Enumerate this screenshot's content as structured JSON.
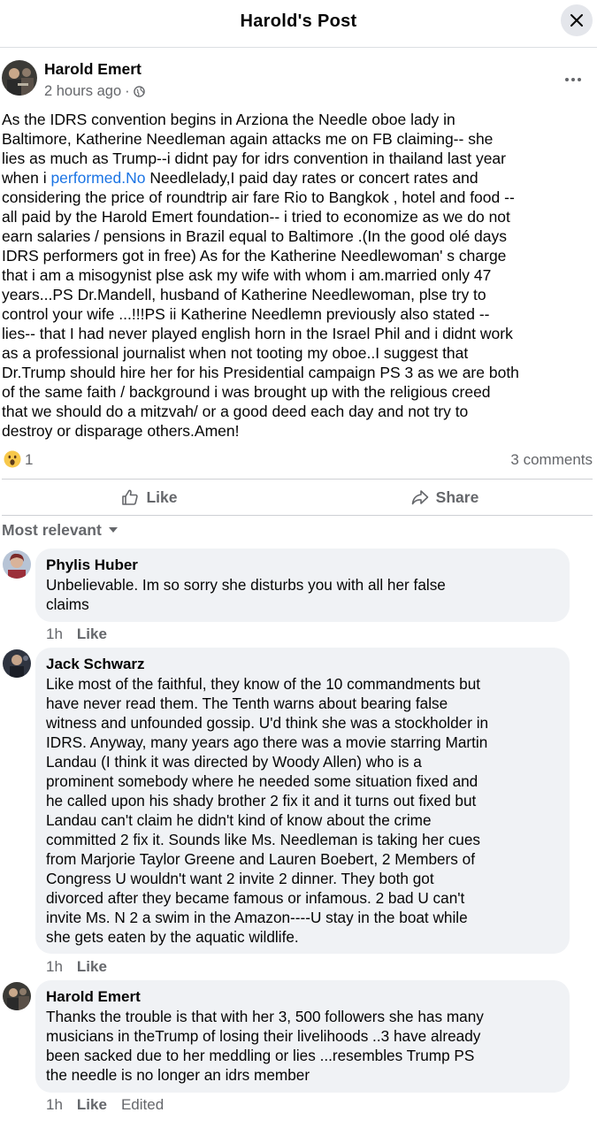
{
  "header": {
    "title": "Harold's Post"
  },
  "post": {
    "author": "Harold Emert",
    "time": "2 hours ago",
    "separator": "·",
    "text_lines": [
      {
        "pre": "As the IDRS convention begins in Arziona the Needle oboe lady in"
      },
      {
        "pre": "Baltimore, Katherine Needleman again  attacks me on FB  claiming-- she"
      },
      {
        "pre": "lies as much as Trump--i didnt pay  for idrs convention in thailand last year"
      },
      {
        "pre": "when i ",
        "link": "performed.No",
        "post": " Needlelady,I paid day rates or concert rates and"
      },
      {
        "pre": "considering the price of roundtrip air fare Rio to Bangkok , hotel and food --"
      },
      {
        "pre": "all paid by the Harold Emert foundation-- i tried to economize as we do not"
      },
      {
        "pre": "earn salaries / pensions in Brazil equal to Baltimore .(In the good olé days"
      },
      {
        "pre": "IDRS performers got in free) As for the Katherine Needlewoman' s charge"
      },
      {
        "pre": "that i am a misogynist plse ask my wife with whom i am.married only 47"
      },
      {
        "pre": "years...PS Dr.Mandell, husband of Katherine Needlewoman,  plse try to"
      },
      {
        "pre": "control your wife ...!!!PS ii Katherine Needlemn previously also  stated --"
      },
      {
        "pre": "lies-- that I had never played english horn in the Israel Phil and i didnt work"
      },
      {
        "pre": "as a professional journalist when not tooting my oboe..I suggest that"
      },
      {
        "pre": "Dr.Trump should hire her for his Presidential  campaign PS 3 as we are both"
      },
      {
        "pre": "of the same faith / background i was brought up with the religious creed"
      },
      {
        "pre": "that we should do a mitzvah/ or a good deed each day and not try to"
      },
      {
        "pre": "destroy or disparage others.Amen!"
      }
    ],
    "reaction_count": "1",
    "comments_count": "3 comments"
  },
  "actions": {
    "like": "Like",
    "share": "Share"
  },
  "sort": {
    "label": "Most relevant"
  },
  "comments": [
    {
      "name": "Phylis Huber",
      "lines": [
        "Unbelievable. Im so sorry she disturbs you with all her false",
        "claims"
      ],
      "time": "1h",
      "like": "Like",
      "edited": ""
    },
    {
      "name": "Jack Schwarz",
      "lines": [
        "Like most of the faithful, they know of the 10 commandments but",
        "have never read them. The Tenth warns about bearing false",
        "witness and unfounded gossip. U'd think she was a stockholder in",
        "IDRS. Anyway, many years ago there was a movie starring Martin",
        "Landau (I think it was directed by Woody Allen) who is a",
        "prominent somebody where he needed some situation fixed and",
        "he called upon his shady brother 2 fix it and it turns out fixed but",
        "Landau can't claim he didn't kind of know about the crime",
        "committed 2 fix it. Sounds like Ms. Needleman is taking her cues",
        "from Marjorie Taylor Greene and Lauren Boebert, 2 Members of",
        "Congress U wouldn't want 2 invite 2 dinner. They both got",
        "divorced after they became famous or infamous. 2 bad U can't",
        "invite Ms. N 2 a swim in the Amazon----U stay in the boat while",
        "she gets eaten by the aquatic wildlife."
      ],
      "time": "1h",
      "like": "Like",
      "edited": ""
    },
    {
      "name": "Harold Emert",
      "lines": [
        "Thanks the trouble is that with her 3, 500 followers she has many",
        "musicians in theTrump of losing their livelihoods ..3 have already",
        "been sacked due to her meddling or lies ...resembles Trump PS",
        "the needle is no longer an idrs member"
      ],
      "time": "1h",
      "like": "Like",
      "edited": "Edited"
    }
  ]
}
